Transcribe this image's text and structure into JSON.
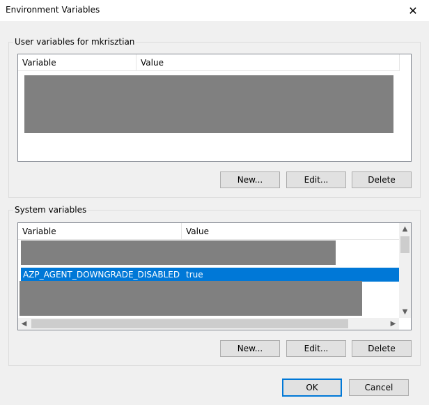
{
  "window": {
    "title": "Environment Variables",
    "close_glyph": "✕"
  },
  "user_vars": {
    "group_label": "User variables for mkrisztian",
    "columns": [
      "Variable",
      "Value"
    ],
    "buttons": {
      "new": "New...",
      "edit": "Edit...",
      "delete": "Delete"
    }
  },
  "system_vars": {
    "group_label": "System variables",
    "columns": [
      "Variable",
      "Value"
    ],
    "selected_row": {
      "variable": "AZP_AGENT_DOWNGRADE_DISABLED",
      "value": "true"
    },
    "buttons": {
      "new": "New...",
      "edit": "Edit...",
      "delete": "Delete"
    }
  },
  "dialog_buttons": {
    "ok": "OK",
    "cancel": "Cancel"
  },
  "colors": {
    "selection": "#0078d7",
    "redaction": "#808080"
  }
}
